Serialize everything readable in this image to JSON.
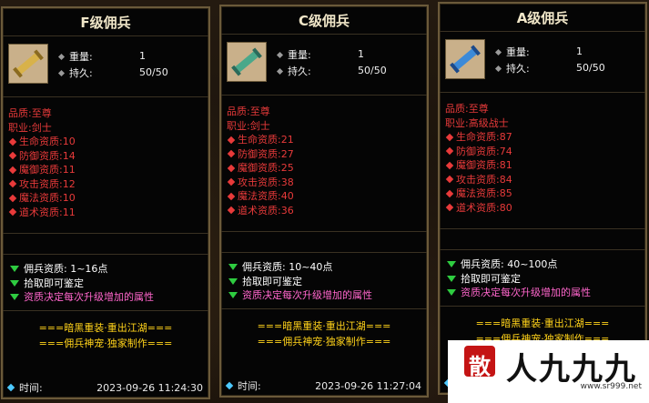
{
  "cards": [
    {
      "title": "F级佣兵",
      "weight_label": "重量:",
      "weight_value": "1",
      "durability_label": "持久:",
      "durability_value": "50/50",
      "quality": "品质:至尊",
      "profession": "职业:剑士",
      "attributes": [
        "生命资质:10",
        "防御资质:14",
        "魔御资质:11",
        "攻击资质:12",
        "魔法资质:10",
        "道术资质:11"
      ],
      "bonus_lines": [
        "佣兵资质: 1~16点",
        "拾取即可鉴定",
        "资质决定每次升级增加的属性"
      ],
      "slogans": [
        "===暗黑重装·重出江湖===",
        "===佣兵神宠·独家制作==="
      ],
      "time_label": "时间:",
      "time_value": "2023-09-26 11:24:30"
    },
    {
      "title": "C级佣兵",
      "weight_label": "重量:",
      "weight_value": "1",
      "durability_label": "持久:",
      "durability_value": "50/50",
      "quality": "品质:至尊",
      "profession": "职业:剑士",
      "attributes": [
        "生命资质:21",
        "防御资质:27",
        "魔御资质:25",
        "攻击资质:38",
        "魔法资质:40",
        "道术资质:36"
      ],
      "bonus_lines": [
        "佣兵资质: 10~40点",
        "拾取即可鉴定",
        "资质决定每次升级增加的属性"
      ],
      "slogans": [
        "===暗黑重装·重出江湖===",
        "===佣兵神宠·独家制作==="
      ],
      "time_label": "时间:",
      "time_value": "2023-09-26 11:27:04"
    },
    {
      "title": "A级佣兵",
      "weight_label": "重量:",
      "weight_value": "1",
      "durability_label": "持久:",
      "durability_value": "50/50",
      "quality": "品质:至尊",
      "profession": "职业:高级战士",
      "attributes": [
        "生命资质:87",
        "防御资质:74",
        "魔御资质:81",
        "攻击资质:84",
        "魔法资质:85",
        "道术资质:80"
      ],
      "bonus_lines": [
        "佣兵资质: 40~100点",
        "拾取即可鉴定",
        "资质决定每次升级增加的属性"
      ],
      "slogans": [
        "===暗黑重装·重出江湖===",
        "===佣兵神宠·独家制作==="
      ],
      "time_label": "",
      "time_value": ""
    }
  ],
  "icons": [
    "scroll-icon",
    "diamond-bullet-icon",
    "green-arrow-icon"
  ],
  "watermark": {
    "seal_char": "散",
    "main_text": "人九九九",
    "url": "www.sr999.net"
  },
  "colors": {
    "red": "#e83a3a",
    "pink": "#ff66cc",
    "gold": "#ffd21a",
    "green": "#2ecc40",
    "border": "#6b5a3a"
  }
}
